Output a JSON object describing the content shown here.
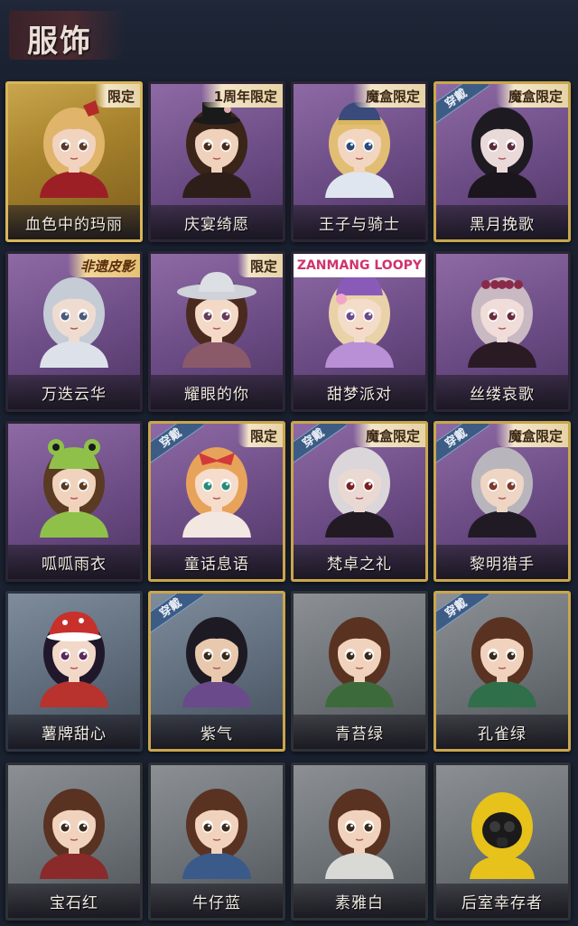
{
  "header": {
    "title": "服饰"
  },
  "costumes": [
    {
      "name": "血色中的玛丽",
      "badge": "限定",
      "badge_style": "limit",
      "worn": false,
      "frame": "gold",
      "hair": "#e0b46a",
      "skin": "#f1d3bf",
      "outfit": "#9c1f26",
      "eyes": "#5a3a2a",
      "hat": "bow"
    },
    {
      "name": "庆宴绮愿",
      "badge": "1周年限定",
      "badge_style": "limit",
      "worn": false,
      "frame": "purple",
      "hair": "#3a2518",
      "skin": "#f0d2bc",
      "outfit": "#2e1e1a",
      "eyes": "#4a2a1a",
      "hat": "tophat"
    },
    {
      "name": "王子与骑士",
      "badge": "魔盒限定",
      "badge_style": "limit",
      "worn": false,
      "frame": "purple",
      "hair": "#e2be74",
      "skin": "#f2d6c2",
      "outfit": "#dfe6ef",
      "eyes": "#2a4a7a",
      "hat": "cap"
    },
    {
      "name": "黑月挽歌",
      "badge": "魔盒限定",
      "badge_style": "limit",
      "worn": true,
      "frame": "purple",
      "hair": "#1e1a22",
      "skin": "#e9d9d9",
      "outfit": "#1b161d",
      "eyes": "#5a2a3a",
      "hat": "none"
    },
    {
      "name": "万迭云华",
      "badge": "非遗皮影",
      "badge_style": "event",
      "worn": false,
      "frame": "purple",
      "hair": "#c5ccd6",
      "skin": "#efdcd0",
      "outfit": "#dde2ea",
      "eyes": "#4a5a7a",
      "hat": "none"
    },
    {
      "name": "耀眼的你",
      "badge": "限定",
      "badge_style": "limit",
      "worn": false,
      "frame": "purple",
      "hair": "#4a2a1e",
      "skin": "#f3d9c6",
      "outfit": "#8a5a6a",
      "eyes": "#6a3a5a",
      "hat": "cowboy"
    },
    {
      "name": "甜梦派对",
      "badge": "ZANMANG LOOPY",
      "badge_style": "loopy",
      "worn": false,
      "frame": "purple",
      "hair": "#ead2a8",
      "skin": "#f4dccb",
      "outfit": "#b98fd6",
      "eyes": "#6a4a8a",
      "hat": "beanie"
    },
    {
      "name": "丝缕哀歌",
      "badge": "",
      "badge_style": "none",
      "worn": false,
      "frame": "purple",
      "hair": "#c9b9c2",
      "skin": "#f0dcd8",
      "outfit": "#2a1a24",
      "eyes": "#6a2a3a",
      "hat": "roses"
    },
    {
      "name": "呱呱雨衣",
      "badge": "",
      "badge_style": "none",
      "worn": false,
      "frame": "purple",
      "hair": "#5a3a22",
      "skin": "#f1d3bd",
      "outfit": "#8fc14a",
      "eyes": "#5a3a22",
      "hat": "frog"
    },
    {
      "name": "童话息语",
      "badge": "限定",
      "badge_style": "limit",
      "worn": true,
      "frame": "purple",
      "hair": "#e8a35a",
      "skin": "#f5dccb",
      "outfit": "#f3e7e2",
      "eyes": "#2a8a7a",
      "hat": "redbow"
    },
    {
      "name": "梵卓之礼",
      "badge": "魔盒限定",
      "badge_style": "limit",
      "worn": true,
      "frame": "purple",
      "hair": "#dad6d9",
      "skin": "#ead9d3",
      "outfit": "#221a22",
      "eyes": "#7a2020",
      "hat": "none"
    },
    {
      "name": "黎明猎手",
      "badge": "魔盒限定",
      "badge_style": "limit",
      "worn": true,
      "frame": "purple",
      "hair": "#b9b5bd",
      "skin": "#efd5c3",
      "outfit": "#1f1a24",
      "eyes": "#7a3a2a",
      "hat": "none"
    },
    {
      "name": "薯牌甜心",
      "badge": "",
      "badge_style": "none",
      "worn": false,
      "frame": "blue",
      "hair": "#20182a",
      "skin": "#f2d8c8",
      "outfit": "#b8322e",
      "eyes": "#5a2a5a",
      "hat": "redhat"
    },
    {
      "name": "紫气",
      "badge": "",
      "badge_style": "none",
      "worn": true,
      "frame": "blue",
      "hair": "#1e1a24",
      "skin": "#e9c9ae",
      "outfit": "#6a4a8a",
      "eyes": "#3a2a1a",
      "hat": "none"
    },
    {
      "name": "青苔绿",
      "badge": "",
      "badge_style": "none",
      "worn": false,
      "frame": "gray",
      "hair": "#5a3222",
      "skin": "#f1d3bd",
      "outfit": "#3d6a3a",
      "eyes": "#3a2a1a",
      "hat": "none"
    },
    {
      "name": "孔雀绿",
      "badge": "",
      "badge_style": "none",
      "worn": true,
      "frame": "gray",
      "hair": "#5a3222",
      "skin": "#f1d3bd",
      "outfit": "#2f6f4a",
      "eyes": "#3a2a1a",
      "hat": "none"
    },
    {
      "name": "宝石红",
      "badge": "",
      "badge_style": "none",
      "worn": false,
      "frame": "gray",
      "hair": "#5a3222",
      "skin": "#f1d3bd",
      "outfit": "#8a2a2a",
      "eyes": "#3a2a1a",
      "hat": "none"
    },
    {
      "name": "牛仔蓝",
      "badge": "",
      "badge_style": "none",
      "worn": false,
      "frame": "gray",
      "hair": "#5a3222",
      "skin": "#f1d3bd",
      "outfit": "#3a5a8a",
      "eyes": "#3a2a1a",
      "hat": "none"
    },
    {
      "name": "素雅白",
      "badge": "",
      "badge_style": "none",
      "worn": false,
      "frame": "gray",
      "hair": "#5a3222",
      "skin": "#f1d3bd",
      "outfit": "#d9d9d6",
      "eyes": "#3a2a1a",
      "hat": "none"
    },
    {
      "name": "后室幸存者",
      "badge": "",
      "badge_style": "none",
      "worn": false,
      "frame": "gray",
      "hair": "#e6c21a",
      "skin": "#2a2a2a",
      "outfit": "#e6c21a",
      "eyes": "#1a1a1a",
      "hat": "hazmat"
    }
  ],
  "worn_label": "穿戴"
}
